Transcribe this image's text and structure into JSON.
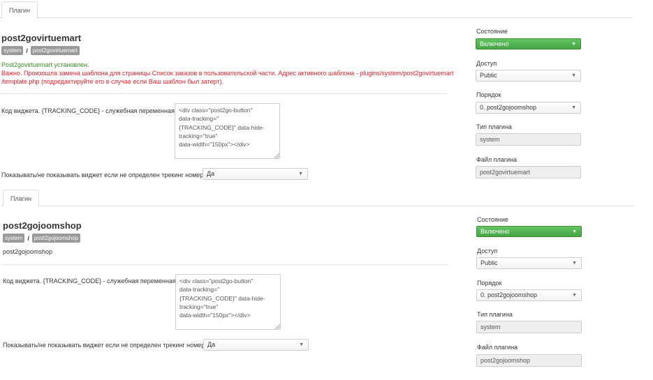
{
  "panels": [
    {
      "tab_label": "Плагин",
      "title": "post2govirtuemart",
      "badges": [
        "system",
        "post2govirtuemart"
      ],
      "badge_separator": "/",
      "message_ok": "Post2govirtuemart установлен.",
      "message_warning": "Важно. Произошла замена шаблона для страницы Список заказов в пользовательской части. Адрес активного шаблона - plugins/system/post2govirtuemart /template.php (подредактируйте его в случае если Ваш шаблон был затерт).",
      "widget_label": "Код виджета. {TRACKING_CODE} - служебная переменная",
      "widget_code": "<div class=\"post2go-button\"\ndata-tracking=\"\n{TRACKING_CODE}\" data-hide-\ntracking=\"true\"\ndata-width=\"150px\"></div>",
      "show_label": "Показывать/не показывать виджет если не определен трекинг номер",
      "show_value": "Да",
      "side": {
        "state_label": "Состояние",
        "state_value": "Включено",
        "access_label": "Доступ",
        "access_value": "Public",
        "order_label": "Порядок",
        "order_value": "0. post2gojoomshop",
        "type_label": "Тип плагина",
        "type_value": "system",
        "file_label": "Файл плагина",
        "file_value": "post2govirtuemart"
      }
    },
    {
      "tab_label": "Плагин",
      "title": "post2gojoomshop",
      "badges": [
        "system",
        "post2gojoomshop"
      ],
      "badge_separator": "/",
      "description": "post2gojoomshop",
      "widget_label": "Код виджета. {TRACKING_CODE} - служебная переменная",
      "widget_code": "<div class=\"post2go-button\"\ndata-tracking=\"\n{TRACKING_CODE}\" data-hide-\ntracking=\"true\"\ndata-width=\"150px\"></div>",
      "show_label": "Показывать/не показывать виджет если не определен трекинг номер",
      "show_value": "Да",
      "side": {
        "state_label": "Состояние",
        "state_value": "Включено",
        "access_label": "Доступ",
        "access_value": "Public",
        "order_label": "Порядок",
        "order_value": "0. post2gojoomshop",
        "type_label": "Тип плагина",
        "type_value": "system",
        "file_label": "Файл плагина",
        "file_value": "post2gojoomshop"
      }
    }
  ],
  "icons": {
    "caret": "chevron-down-icon",
    "grip": "resize-grip-icon"
  },
  "colors": {
    "success_text": "#3a8c22",
    "warning_text": "#e0202a",
    "status_green": "#46a546",
    "badge_grey": "#999999"
  }
}
